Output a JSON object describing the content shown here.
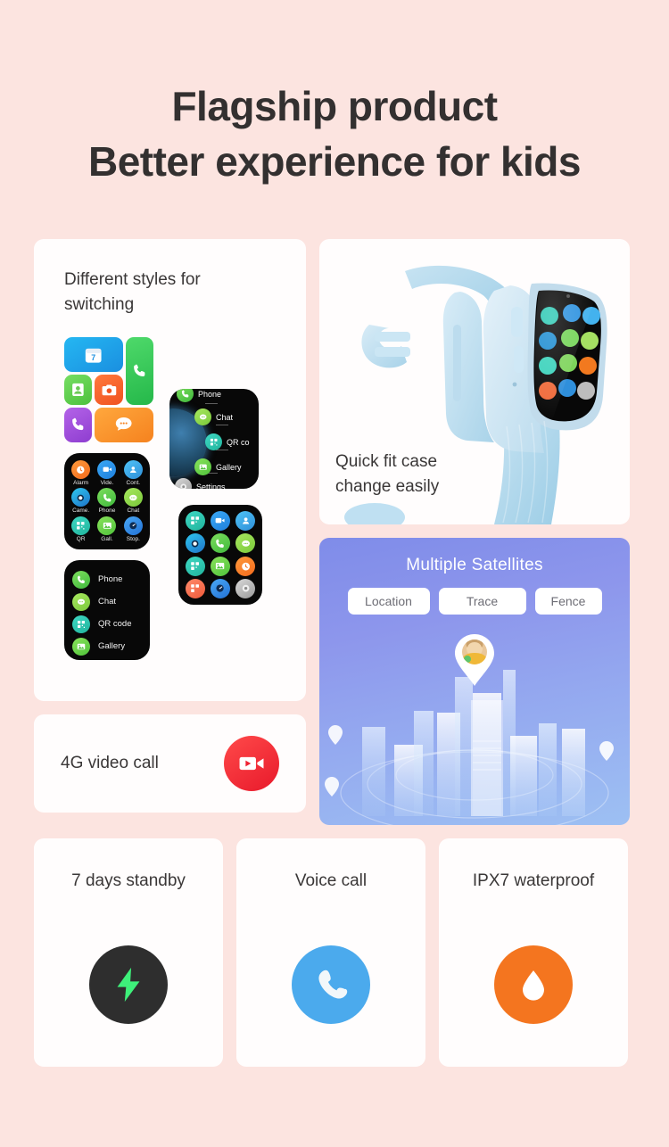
{
  "headline": {
    "line1": "Flagship product",
    "line2": "Better experience for kids"
  },
  "cards": {
    "styles": {
      "title": "Different styles for switching",
      "tile_icons": [
        "calendar-7",
        "phone",
        "contacts",
        "camera",
        "dial",
        "chat"
      ],
      "calendar_day": "7",
      "grid9_labels": [
        "Alarm",
        "Vide.",
        "Cont.",
        "Came.",
        "Phone",
        "Chat",
        "QR",
        "Gall.",
        "Stop."
      ],
      "list_items": [
        "Phone",
        "Chat",
        "QR code",
        "Gallery"
      ],
      "globe_items": [
        "Phone",
        "Chat",
        "QR co",
        "Gallery",
        "Settings"
      ]
    },
    "watch": {
      "title": "Quick fit case change easily"
    },
    "satellites": {
      "title": "Multiple Satellites",
      "chips": [
        "Location",
        "Trace",
        "Fence"
      ]
    },
    "video": {
      "title": "4G video call",
      "icon": "video-camera-icon"
    },
    "features": [
      {
        "title": "7 days standby",
        "icon": "lightning-bolt-icon",
        "color": "#2e2e2e"
      },
      {
        "title": "Voice call",
        "icon": "phone-handset-icon",
        "color": "#4baaed"
      },
      {
        "title": "IPX7 waterproof",
        "icon": "water-drop-icon",
        "color": "#f4751f"
      }
    ]
  },
  "colors": {
    "background": "#fce4e0",
    "card": "#fffdfd",
    "text": "#3a3737",
    "satellite_gradient_start": "#7f8ce9",
    "satellite_gradient_end": "#9dc0f3",
    "video_badge": "#e8192b"
  }
}
